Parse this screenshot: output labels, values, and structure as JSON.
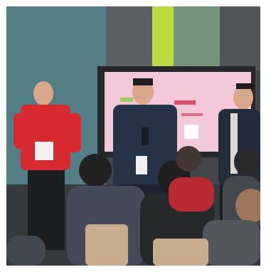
{
  "photo": {
    "screen_text": {
      "line1": "",
      "line2": ""
    },
    "colors": {
      "wall_left": "#3f6b73",
      "wall_mid": "#4b4f52",
      "green_accent": "#b9d93a",
      "screen_bg": "#f3c7d8",
      "screen_frame": "#1d1f22",
      "red_shirt": "#d72128",
      "navy_jacket": "#1e2a3f",
      "dark_jacket": "#1b2433",
      "chair": "#c7a98a"
    }
  }
}
